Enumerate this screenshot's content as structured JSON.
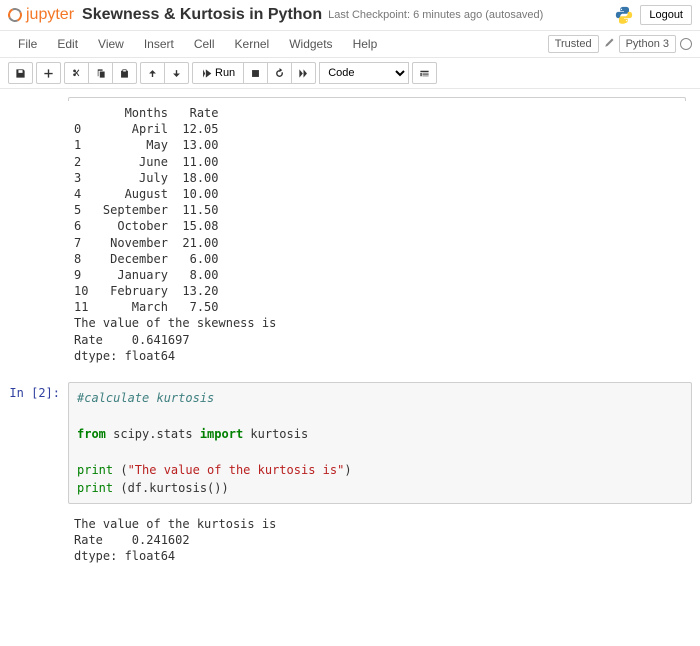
{
  "header": {
    "logo_text": "jupyter",
    "title": "Skewness & Kurtosis in Python",
    "checkpoint": "Last Checkpoint: 6 minutes ago  (autosaved)",
    "logout": "Logout"
  },
  "menubar": {
    "items": [
      "File",
      "Edit",
      "View",
      "Insert",
      "Cell",
      "Kernel",
      "Widgets",
      "Help"
    ],
    "trusted": "Trusted",
    "kernel": "Python 3"
  },
  "toolbar": {
    "run": "Run",
    "celltype": "Code"
  },
  "output1": {
    "header": "       Months   Rate",
    "rows": [
      "0       April  12.05",
      "1         May  13.00",
      "2        June  11.00",
      "3        July  18.00",
      "4      August  10.00",
      "5   September  11.50",
      "6     October  15.08",
      "7    November  21.00",
      "8    December   6.00",
      "9     January   8.00",
      "10   February  13.20",
      "11      March   7.50"
    ],
    "skew_label": "The value of the skewness is",
    "skew_value": "Rate    0.641697",
    "dtype": "dtype: float64"
  },
  "cell2": {
    "prompt": "In [2]:",
    "comment": "#calculate kurtosis",
    "import_from": "from",
    "import_mod": " scipy.stats ",
    "import_kw": "import",
    "import_name": " kurtosis",
    "print1_fn": "print",
    "print1_paren_open": " (",
    "print1_str": "\"The value of the kurtosis is\"",
    "print1_paren_close": ")",
    "print2_fn": "print",
    "print2_paren_open": " (",
    "print2_expr": "df.kurtosis()",
    "print2_paren_close": ")"
  },
  "output2": {
    "label": "The value of the kurtosis is",
    "value": "Rate    0.241602",
    "dtype": "dtype: float64"
  }
}
